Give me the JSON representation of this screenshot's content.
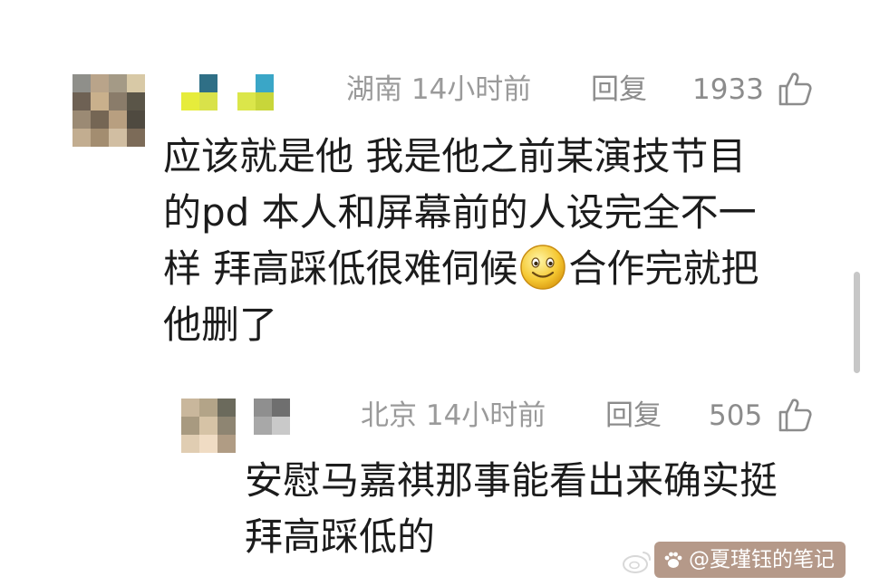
{
  "comments": [
    {
      "location_time": "湖南 14小时前",
      "reply_label": "回复",
      "like_count": "1933",
      "lines": [
        "应该就是他 我是他之前某演技节目",
        "的pd 本人和屏幕前的人设完全不一",
        "样 拜高踩低很难伺候",
        "合作完就把",
        "他删了"
      ],
      "emoji": "smiling-face-emoji"
    },
    {
      "location_time": "北京 14小时前",
      "reply_label": "回复",
      "like_count": "505",
      "lines": [
        "安慰马嘉祺那事能看出来确实挺",
        "拜高踩低的"
      ]
    }
  ],
  "watermark": {
    "text": "@夏瑾钰的笔记"
  },
  "icons": {
    "like": "thumbs-up-icon",
    "watermark": "paw-icon",
    "platform": "weibo-logo-icon"
  },
  "colors": {
    "meta_text": "#9a9a9a",
    "body_text": "#1c1c1c",
    "background": "#ffffff",
    "watermark_bg": "#784628"
  }
}
